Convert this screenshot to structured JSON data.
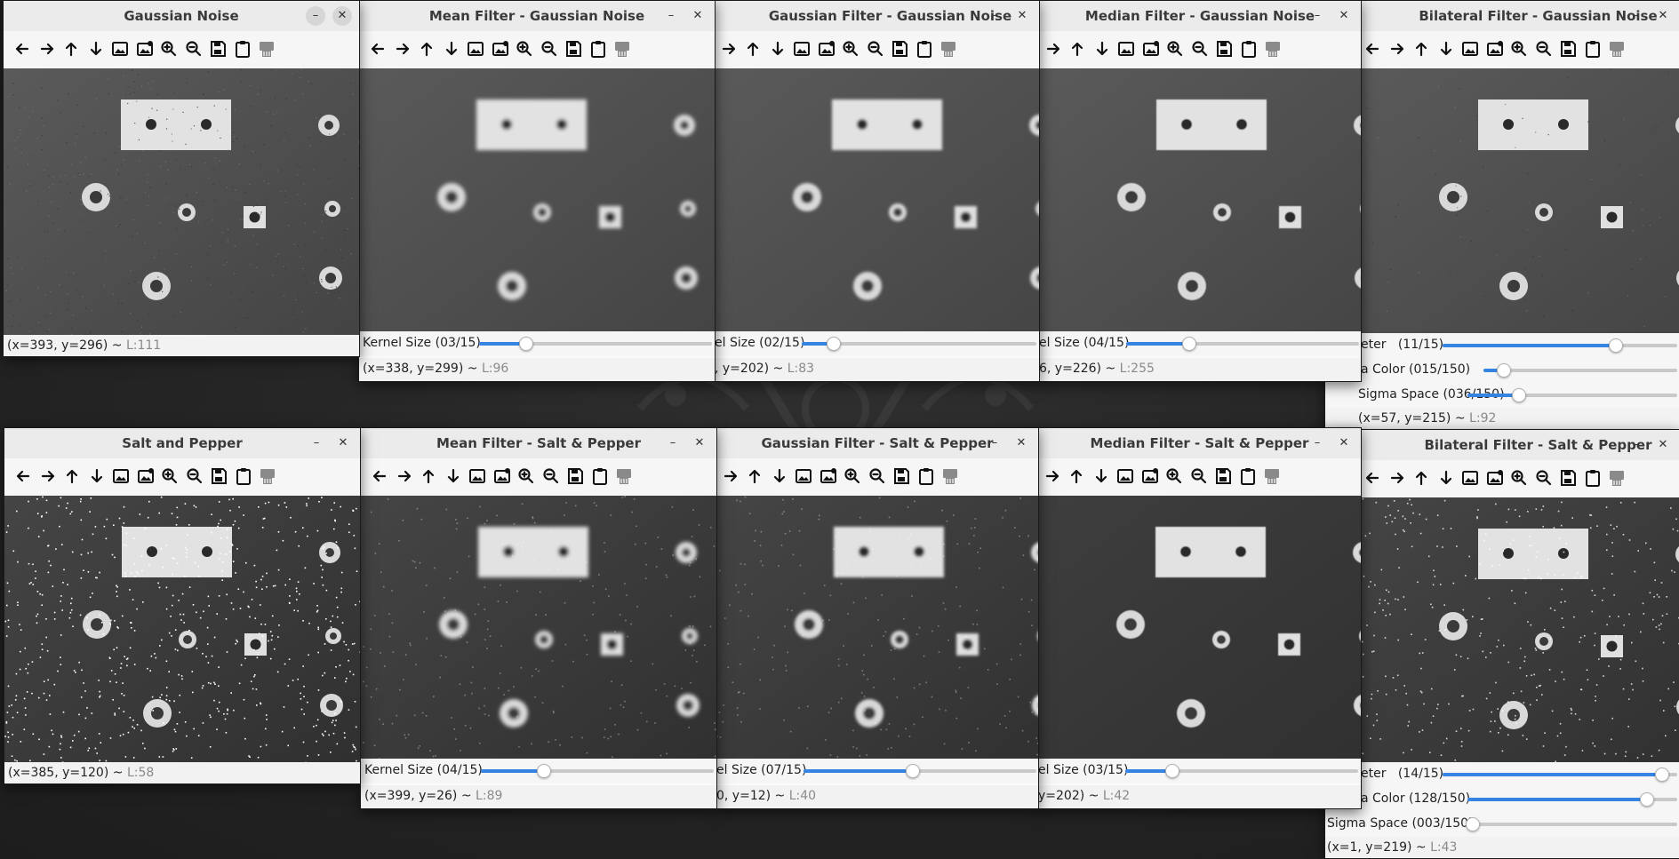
{
  "toolbar_icons": [
    "arrow-left-icon",
    "arrow-right-icon",
    "arrow-up-icon",
    "arrow-down-icon",
    "image-icon",
    "image-settings-icon",
    "zoom-in-icon",
    "zoom-out-icon",
    "save-icon",
    "clipboard-icon",
    "properties-icon"
  ],
  "colors": {
    "accent": "#3584e4",
    "titlebar": "#ebebeb",
    "desktop": "#262626"
  },
  "windows": [
    {
      "title": "Gaussian Noise",
      "coord": "(x=393, y=296)",
      "lum": "L:111",
      "noise": "gaussian",
      "filter": "none"
    },
    {
      "title": "Mean Filter - Gaussian Noise",
      "coord": "(x=338, y=299)",
      "lum": "L:96",
      "noise": "gaussian",
      "filter": "mean",
      "sliders": [
        {
          "label": "Kernel Size (03/15)",
          "value": 3,
          "max": 15
        }
      ]
    },
    {
      "title": "Gaussian Filter - Gaussian Noise",
      "coord": ", y=202)",
      "lum": "L:83",
      "noise": "gaussian",
      "filter": "gaussian",
      "sliders": [
        {
          "label": "el Size (02/15)",
          "value": 2,
          "max": 15
        }
      ]
    },
    {
      "title": "Median Filter - Gaussian Noise",
      "coord": "6, y=226)",
      "lum": "L:255",
      "noise": "gaussian",
      "filter": "median",
      "sliders": [
        {
          "label": "el Size (04/15)",
          "value": 4,
          "max": 15
        }
      ]
    },
    {
      "title": "Bilateral Filter - Gaussian Noise",
      "coord": "(x=57, y=215)",
      "lum": "L:92",
      "noise": "gaussian",
      "filter": "bilateral",
      "sliders": [
        {
          "label": "eter   (11/15)",
          "value": 11,
          "max": 15
        },
        {
          "label": "a Color (015/150)",
          "value": 15,
          "max": 150
        },
        {
          "label": "Sigma Space (036/150)",
          "value": 36,
          "max": 150
        }
      ]
    },
    {
      "title": "Salt and Pepper",
      "coord": "(x=385, y=120)",
      "lum": "L:58",
      "noise": "saltpepper",
      "filter": "none"
    },
    {
      "title": "Mean Filter - Salt & Pepper",
      "coord": "(x=399, y=26)",
      "lum": "L:89",
      "noise": "saltpepper",
      "filter": "mean",
      "sliders": [
        {
          "label": "Kernel Size (04/15)",
          "value": 4,
          "max": 15
        }
      ]
    },
    {
      "title": "Gaussian Filter - Salt & Pepper",
      "coord": "0, y=12)",
      "lum": "L:40",
      "noise": "saltpepper",
      "filter": "gaussian",
      "sliders": [
        {
          "label": "el Size (07/15)",
          "value": 7,
          "max": 15
        }
      ]
    },
    {
      "title": "Median Filter - Salt & Pepper",
      "coord": "y=202)",
      "lum": "L:42",
      "noise": "saltpepper",
      "filter": "median",
      "sliders": [
        {
          "label": "el Size (03/15)",
          "value": 3,
          "max": 15
        }
      ]
    },
    {
      "title": "Bilateral Filter - Salt & Pepper",
      "coord": "(x=1, y=219)",
      "lum": "L:43",
      "noise": "saltpepper",
      "filter": "bilateral",
      "sliders": [
        {
          "label": "eter   (14/15)",
          "value": 14,
          "max": 15
        },
        {
          "label": "a Color (128/150)",
          "value": 128,
          "max": 150
        },
        {
          "label": "Sigma Space (003/150)",
          "value": 3,
          "max": 150
        }
      ]
    }
  ]
}
